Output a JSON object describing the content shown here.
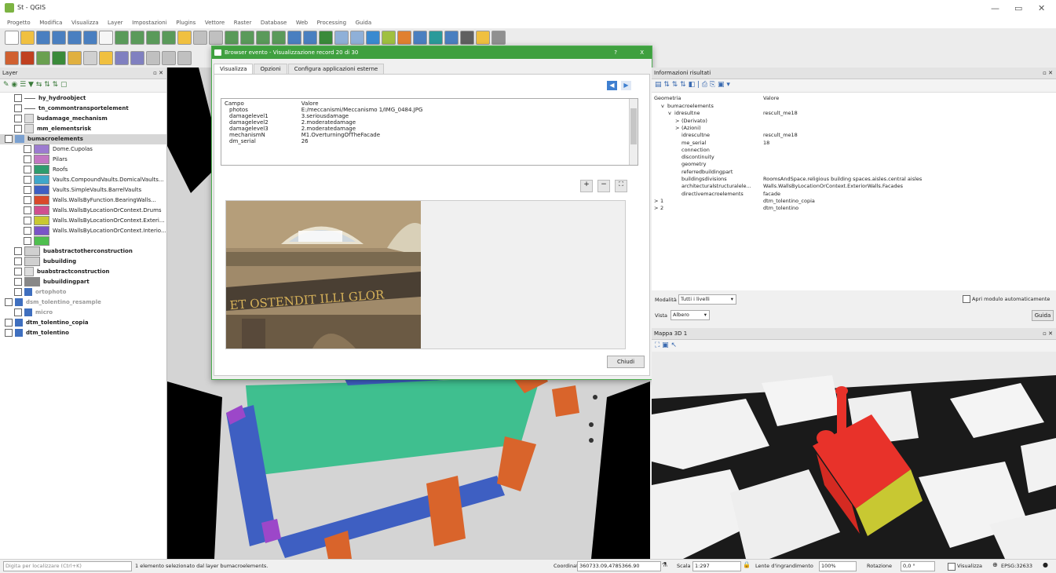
{
  "window": {
    "title": "St - QGIS"
  },
  "menu": [
    "Progetto",
    "Modifica",
    "Visualizza",
    "Layer",
    "Impostazioni",
    "Plugins",
    "Vettore",
    "Raster",
    "Database",
    "Web",
    "Processing",
    "Guida"
  ],
  "layers_panel": {
    "title": "Layer",
    "items": [
      {
        "label": "hy_hydroobject",
        "style": "bold",
        "swatch": "#666666",
        "indent": 1,
        "kind": "line"
      },
      {
        "label": "tn_commontransportelement",
        "style": "bold",
        "swatch": "#666666",
        "indent": 1,
        "kind": "line"
      },
      {
        "label": "budamage_mechanism",
        "style": "bold",
        "swatch": "",
        "indent": 1,
        "kind": "table"
      },
      {
        "label": "mm_elementsrisk",
        "style": "bold",
        "swatch": "",
        "indent": 1,
        "kind": "table"
      },
      {
        "label": "bumacroelements",
        "style": "bold-selected",
        "swatch": "",
        "indent": 0,
        "kind": "group"
      },
      {
        "label": "Dome.Cupolas",
        "style": "",
        "swatch": "#9c7bd0",
        "indent": 2,
        "kind": "fill"
      },
      {
        "label": "Pilars",
        "style": "",
        "swatch": "#c277c2",
        "indent": 2,
        "kind": "fill"
      },
      {
        "label": "Roofs",
        "style": "",
        "swatch": "#2e9c6e",
        "indent": 2,
        "kind": "fill"
      },
      {
        "label": "Vaults.CompoundVaults.DomicalVaults...",
        "style": "",
        "swatch": "#3fa7c9",
        "indent": 2,
        "kind": "fill"
      },
      {
        "label": "Vaults.SimpleVaults.BarrelVaults",
        "style": "",
        "swatch": "#3e5fc2",
        "indent": 2,
        "kind": "fill"
      },
      {
        "label": "Walls.WallsByFunction.BearingWalls...",
        "style": "",
        "swatch": "#d94a2b",
        "indent": 2,
        "kind": "fill"
      },
      {
        "label": "Walls.WallsByLocationOrContext.Drums",
        "style": "",
        "swatch": "#d04f8e",
        "indent": 2,
        "kind": "fill"
      },
      {
        "label": "Walls.WallsByLocationOrContext.Exteri...",
        "style": "",
        "swatch": "#c8c832",
        "indent": 2,
        "kind": "fill"
      },
      {
        "label": "Walls.WallsByLocationOrContext.Interio...",
        "style": "",
        "swatch": "#7a54c7",
        "indent": 2,
        "kind": "fill"
      },
      {
        "label": "",
        "style": "",
        "swatch": "#4fbf4f",
        "indent": 2,
        "kind": "fill"
      },
      {
        "label": "buabstractotherconstruction",
        "style": "bold",
        "swatch": "#d0d0d0",
        "indent": 1,
        "kind": "fill"
      },
      {
        "label": "bubuilding",
        "style": "bold",
        "swatch": "#d0d0d0",
        "indent": 1,
        "kind": "fill"
      },
      {
        "label": "buabstractconstruction",
        "style": "bold",
        "swatch": "",
        "indent": 1,
        "kind": "table"
      },
      {
        "label": "bubuildingpart",
        "style": "bold",
        "swatch": "#888888",
        "indent": 1,
        "kind": "fill"
      },
      {
        "label": "ortophoto",
        "style": "grey",
        "swatch": "#3f6fbf",
        "indent": 1,
        "kind": "raster"
      },
      {
        "label": "dsm_tolentino_resample",
        "style": "grey",
        "swatch": "#3f6fbf",
        "indent": 0,
        "kind": "raster"
      },
      {
        "label": "micro",
        "style": "grey",
        "swatch": "#3f6fbf",
        "indent": 1,
        "kind": "raster"
      },
      {
        "label": "dtm_tolentino_copia",
        "style": "bold",
        "swatch": "#3f6fbf",
        "indent": 0,
        "kind": "raster"
      },
      {
        "label": "dtm_tolentino",
        "style": "bold",
        "swatch": "#3f6fbf",
        "indent": 0,
        "kind": "raster"
      }
    ]
  },
  "dialog": {
    "title": "Browser evento - Visualizzazione record 20 di 30",
    "help": "?",
    "close_x": "X",
    "tabs": [
      "Visualizza",
      "Opzioni",
      "Configura applicazioni esterne"
    ],
    "table_header": {
      "field": "Campo",
      "value": "Valore"
    },
    "rows": [
      {
        "field": "photos",
        "value": "E:/meccanismi/Meccanismo 1/IMG_0484.JPG"
      },
      {
        "field": "damagelevel1",
        "value": "3.seriousdamage"
      },
      {
        "field": "damagelevel2",
        "value": "2.moderatedamage"
      },
      {
        "field": "damagelevel3",
        "value": "2.moderatedamage"
      },
      {
        "field": "mechanismN",
        "value": "M1.OverturningOfTheFacade"
      },
      {
        "field": "dm_serial",
        "value": "26"
      }
    ],
    "photo_text": "ET OSTENDIT ILLI GLOR",
    "close_button": "Chiudi"
  },
  "info_panel": {
    "title": "Informazioni risultati",
    "header": {
      "col1": "Geometria",
      "col2": "Valore"
    },
    "rows": [
      {
        "k": "bumacroelements",
        "v": "",
        "indent": 1,
        "arrow": "v"
      },
      {
        "k": "idresultne",
        "v": "rescult_me18",
        "indent": 2,
        "arrow": "v"
      },
      {
        "k": "(Derivato)",
        "v": "",
        "indent": 3,
        "arrow": ">"
      },
      {
        "k": "(Azioni)",
        "v": "",
        "indent": 3,
        "arrow": ">"
      },
      {
        "k": "idrescultne",
        "v": "rescult_me18",
        "indent": 3,
        "arrow": ""
      },
      {
        "k": "me_serial",
        "v": "18",
        "indent": 3,
        "arrow": ""
      },
      {
        "k": "connection",
        "v": "",
        "indent": 3,
        "arrow": ""
      },
      {
        "k": "discontinuity",
        "v": "",
        "indent": 3,
        "arrow": ""
      },
      {
        "k": "geometry",
        "v": "",
        "indent": 3,
        "arrow": ""
      },
      {
        "k": "referredbuildingpart",
        "v": "",
        "indent": 3,
        "arrow": ""
      },
      {
        "k": "buildingsdivisions",
        "v": "RoomsAndSpace.religious building spaces.aisles.central aisles",
        "indent": 3,
        "arrow": ""
      },
      {
        "k": "architecturalstructuralele...",
        "v": "Walls.WallsByLocationOrContext.ExteriorWalls.Facades",
        "indent": 3,
        "arrow": ""
      },
      {
        "k": "directivemacroelements",
        "v": "facade",
        "indent": 3,
        "arrow": ""
      },
      {
        "k": "1",
        "v": "dtm_tolentino_copia",
        "indent": 0,
        "arrow": ">"
      },
      {
        "k": "2",
        "v": "dtm_tolentino",
        "indent": 0,
        "arrow": ">"
      }
    ],
    "mode_label": "Modalità",
    "mode_value": "Tutti i livelli",
    "auto_open_label": "Apri modulo automaticamente",
    "view_label": "Vista",
    "view_value": "Albero",
    "help_button": "Guida"
  },
  "map3d": {
    "title": "Mappa 3D 1"
  },
  "status": {
    "locator_placeholder": "Digita per localizzare (Ctrl+K)",
    "message": "1 elemento selezionato dal layer bumacroelements.",
    "coord_label": "Coordinate",
    "coord_value": "360733.09,4785366.90",
    "scale_label": "Scala",
    "scale_value": "1:297",
    "magnifier_label": "Lente d'ingrandimento",
    "magnifier_value": "100%",
    "rotation_label": "Rotazione",
    "rotation_value": "0,0 °",
    "render_label": "Visualizza",
    "crs": "EPSG:32633"
  },
  "colors": {
    "dialog_green": "#3fa03f",
    "roof_green": "#3fbf8f",
    "vault_blue": "#3e5fc2",
    "walls_orange": "#d9642b",
    "church_red": "#e8322a",
    "facade_yellow": "#c8c832"
  }
}
